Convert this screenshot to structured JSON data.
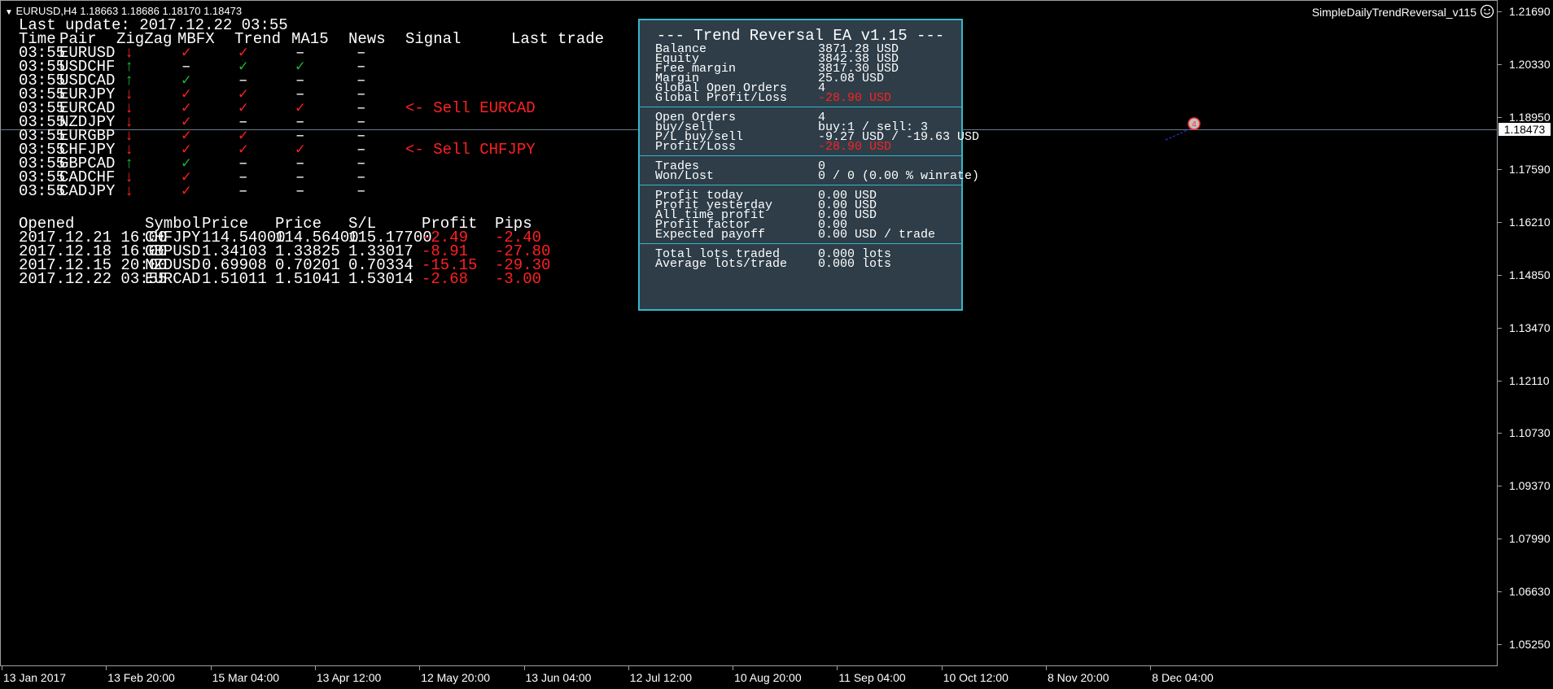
{
  "header": {
    "symbol_line": "EURUSD,H4  1.18663 1.18686 1.18170 1.18473",
    "ea_name": "SimpleDailyTrendReversal_v115"
  },
  "dashboard": {
    "last_update": "Last update: 2017.12.22 03:55",
    "columns": [
      "Time",
      "Pair",
      "ZigZag",
      "MBFX",
      "Trend",
      "MA15",
      "News",
      "Signal",
      "Last trade"
    ],
    "rows": [
      {
        "time": "03:55",
        "pair": "EURUSD",
        "zz": "down",
        "mbfx": "✓",
        "mbfx_c": "red",
        "trend": "✓",
        "trend_c": "red",
        "ma": "–",
        "ma_c": "white",
        "news": "–",
        "signal": ""
      },
      {
        "time": "03:55",
        "pair": "USDCHF",
        "zz": "up",
        "mbfx": "–",
        "mbfx_c": "white",
        "trend": "✓",
        "trend_c": "green",
        "ma": "✓",
        "ma_c": "green",
        "news": "–",
        "signal": ""
      },
      {
        "time": "03:55",
        "pair": "USDCAD",
        "zz": "up",
        "mbfx": "✓",
        "mbfx_c": "green",
        "trend": "–",
        "trend_c": "white",
        "ma": "–",
        "ma_c": "white",
        "news": "–",
        "signal": ""
      },
      {
        "time": "03:55",
        "pair": "EURJPY",
        "zz": "down",
        "mbfx": "✓",
        "mbfx_c": "red",
        "trend": "✓",
        "trend_c": "red",
        "ma": "–",
        "ma_c": "white",
        "news": "–",
        "signal": ""
      },
      {
        "time": "03:55",
        "pair": "EURCAD",
        "zz": "down",
        "mbfx": "✓",
        "mbfx_c": "red",
        "trend": "✓",
        "trend_c": "red",
        "ma": "✓",
        "ma_c": "red",
        "news": "–",
        "signal": "<- Sell  EURCAD"
      },
      {
        "time": "03:55",
        "pair": "NZDJPY",
        "zz": "down",
        "mbfx": "✓",
        "mbfx_c": "red",
        "trend": "–",
        "trend_c": "white",
        "ma": "–",
        "ma_c": "white",
        "news": "–",
        "signal": ""
      },
      {
        "time": "03:55",
        "pair": "EURGBP",
        "zz": "down",
        "mbfx": "✓",
        "mbfx_c": "red",
        "trend": "✓",
        "trend_c": "red",
        "ma": "–",
        "ma_c": "white",
        "news": "–",
        "signal": ""
      },
      {
        "time": "03:55",
        "pair": "CHFJPY",
        "zz": "down",
        "mbfx": "✓",
        "mbfx_c": "red",
        "trend": "✓",
        "trend_c": "red",
        "ma": "✓",
        "ma_c": "red",
        "news": "–",
        "signal": "<- Sell  CHFJPY"
      },
      {
        "time": "03:55",
        "pair": "GBPCAD",
        "zz": "up",
        "mbfx": "✓",
        "mbfx_c": "green",
        "trend": "–",
        "trend_c": "white",
        "ma": "–",
        "ma_c": "white",
        "news": "–",
        "signal": ""
      },
      {
        "time": "03:55",
        "pair": "CADCHF",
        "zz": "down",
        "mbfx": "✓",
        "mbfx_c": "red",
        "trend": "–",
        "trend_c": "white",
        "ma": "–",
        "ma_c": "white",
        "news": "–",
        "signal": ""
      },
      {
        "time": "03:55",
        "pair": "CADJPY",
        "zz": "down",
        "mbfx": "✓",
        "mbfx_c": "red",
        "trend": "–",
        "trend_c": "white",
        "ma": "–",
        "ma_c": "white",
        "news": "–",
        "signal": ""
      }
    ],
    "orders_columns": [
      "Opened",
      "Symbol",
      "Price",
      "Price",
      "S/L",
      "Profit",
      "Pips"
    ],
    "orders": [
      {
        "opened": "2017.12.21 16:00",
        "symbol": "CHFJPY",
        "open": "114.54000",
        "price": "114.56400",
        "sl": "115.17700",
        "profit": "-2.49",
        "pips": "-2.40"
      },
      {
        "opened": "2017.12.18 16:00",
        "symbol": "GBPUSD",
        "open": "1.34103",
        "price": "1.33825",
        "sl": "1.33017",
        "profit": "-8.91",
        "pips": "-27.80"
      },
      {
        "opened": "2017.12.15 20:00",
        "symbol": "NZDUSD",
        "open": "0.69908",
        "price": "0.70201",
        "sl": "0.70334",
        "profit": "-15.15",
        "pips": "-29.30"
      },
      {
        "opened": "2017.12.22 03:55",
        "symbol": "EURCAD",
        "open": "1.51011",
        "price": "1.51041",
        "sl": "1.53014",
        "profit": "-2.68",
        "pips": "-3.00"
      }
    ]
  },
  "panel": {
    "title": "--- Trend Reversal EA v1.15 ---",
    "sections": [
      [
        {
          "label": "Balance",
          "value": "3871.28 USD",
          "color": "white"
        },
        {
          "label": "Equity",
          "value": "3842.38 USD",
          "color": "white"
        },
        {
          "label": "Free margin",
          "value": "3817.30 USD",
          "color": "white"
        },
        {
          "label": "Margin",
          "value": "25.08 USD",
          "color": "white"
        },
        {
          "label": "Global Open Orders",
          "value": "4",
          "color": "white"
        },
        {
          "label": "Global Profit/Loss",
          "value": "-28.90 USD",
          "color": "red"
        }
      ],
      [
        {
          "label": "Open Orders",
          "value": "4",
          "color": "white"
        },
        {
          "label": "       buy/sell",
          "value": " buy:1 / sell: 3",
          "color": "white"
        },
        {
          "label": "    P/L buy/sell",
          "value": "-9.27 USD / -19.63 USD",
          "color": "white"
        },
        {
          "label": "Profit/Loss",
          "value": "-28.90 USD",
          "color": "red"
        }
      ],
      [
        {
          "label": "Trades",
          "value": "0",
          "color": "white"
        },
        {
          "label": "Won/Lost",
          "value": "0 / 0 (0.00 % winrate)",
          "color": "white"
        }
      ],
      [
        {
          "label": "Profit today",
          "value": "0.00 USD",
          "color": "white"
        },
        {
          "label": "Profit yesterday",
          "value": "0.00 USD",
          "color": "white"
        },
        {
          "label": "All time profit",
          "value": "0.00 USD",
          "color": "white"
        },
        {
          "label": "Profit factor",
          "value": "0.00",
          "color": "white"
        },
        {
          "label": "Expected payoff",
          "value": "0.00 USD / trade",
          "color": "white"
        }
      ],
      [
        {
          "label": "Total lots traded",
          "value": "0.000 lots",
          "color": "white"
        },
        {
          "label": "Average lots/trade",
          "value": "0.000 lots",
          "color": "white"
        }
      ]
    ]
  },
  "yaxis": [
    "1.21690",
    "1.20330",
    "1.18950",
    "1.17590",
    "1.16210",
    "1.14850",
    "1.13470",
    "1.12110",
    "1.10730",
    "1.09370",
    "1.07990",
    "1.06630",
    "1.05250"
  ],
  "current_price": "1.18473",
  "xaxis": [
    "13 Jan 2017",
    "13 Feb 20:00",
    "15 Mar 04:00",
    "13 Apr 12:00",
    "12 May 20:00",
    "13 Jun 04:00",
    "12 Jul 12:00",
    "10 Aug 20:00",
    "11 Sep 04:00",
    "10 Oct 12:00",
    "8 Nov 20:00",
    "8 Dec 04:00"
  ],
  "colors": {
    "panel_bg": "#2e3d48",
    "panel_border": "#35b6c8",
    "loss": "#ff2020",
    "gain": "#1eb43a"
  }
}
